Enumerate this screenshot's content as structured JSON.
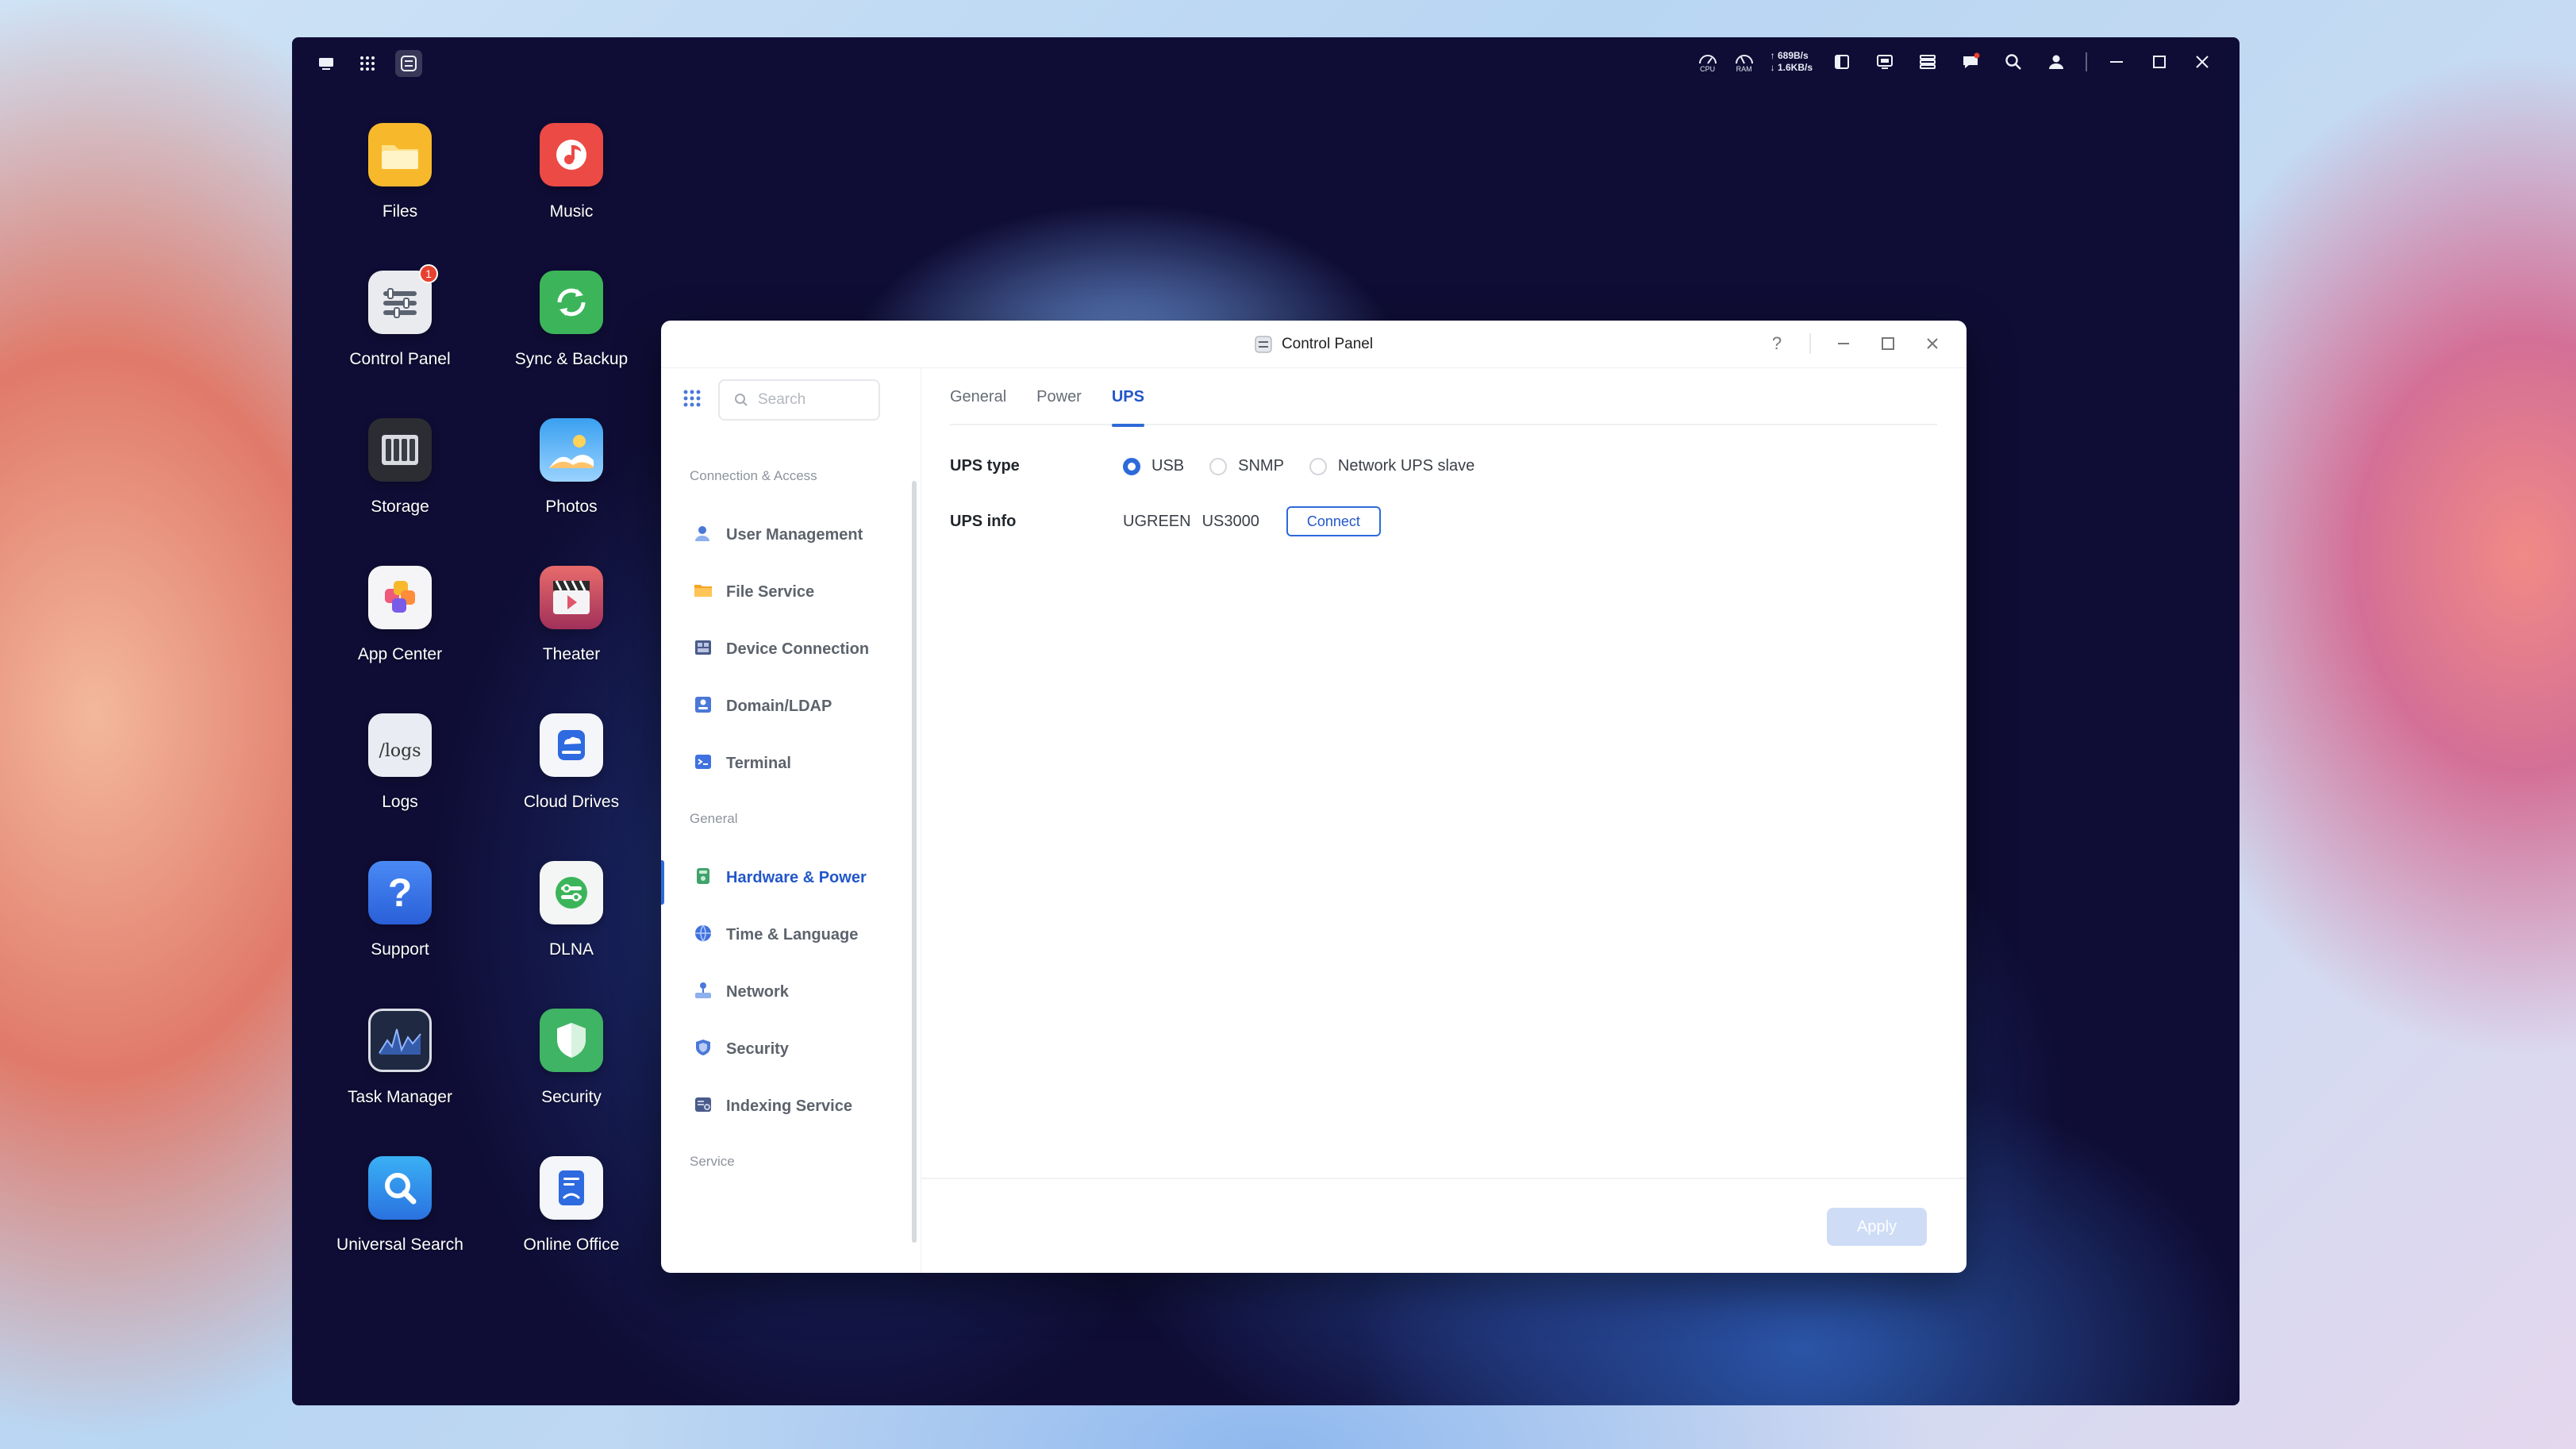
{
  "desktop": {
    "icons": [
      {
        "label": "Files",
        "icon": "folder-icon",
        "color": "#f7b92b"
      },
      {
        "label": "Music",
        "icon": "music-note-icon",
        "color": "#ec4a45"
      },
      {
        "label": "Control Panel",
        "icon": "sliders-icon",
        "color": "#e9ebef",
        "badge": "1"
      },
      {
        "label": "Sync & Backup",
        "icon": "sync-icon",
        "color": "#3cb55a"
      },
      {
        "label": "Storage",
        "icon": "drive-bay-icon",
        "color": "#2b2d33"
      },
      {
        "label": "Photos",
        "icon": "landscape-icon",
        "color": "#3aa0f0"
      },
      {
        "label": "App Center",
        "icon": "app-blocks-icon",
        "color": "#f5f5f7"
      },
      {
        "label": "Theater",
        "icon": "clapperboard-icon",
        "color": "#b23b5d"
      },
      {
        "label": "Logs",
        "icon": "logs-icon",
        "color": "#e9ecf2",
        "text": "/logs"
      },
      {
        "label": "Cloud Drives",
        "icon": "cloud-drive-icon",
        "color": "#f4f6fa"
      },
      {
        "label": "Support",
        "icon": "question-icon",
        "color": "#2e6ae0"
      },
      {
        "label": "DLNA",
        "icon": "dlna-icon",
        "color": "#f4f6f5"
      },
      {
        "label": "Task Manager",
        "icon": "activity-graph-icon",
        "color": "#1f2942"
      },
      {
        "label": "Security",
        "icon": "shield-icon",
        "color": "#3fb464"
      },
      {
        "label": "Universal Search",
        "icon": "search-icon",
        "color": "#2a8ae8"
      },
      {
        "label": "Online Office",
        "icon": "document-icon",
        "color": "#f4f6fa"
      }
    ]
  },
  "topbar": {
    "monitor": {
      "cpu": "CPU",
      "ram": "RAM",
      "up": "↑ 689B/s",
      "down": "↓ 1.6KB/s"
    }
  },
  "window": {
    "title": "Control Panel",
    "search_placeholder": "Search",
    "nav": [
      {
        "type": "section",
        "label": "Connection & Access"
      },
      {
        "type": "item",
        "label": "User Management",
        "icon": "user-icon",
        "color": "#4b78d8"
      },
      {
        "type": "item",
        "label": "File Service",
        "icon": "folder-icon",
        "color": "#f5a623"
      },
      {
        "type": "item",
        "label": "Device Connection",
        "icon": "device-icon",
        "color": "#4a5b8a"
      },
      {
        "type": "item",
        "label": "Domain/LDAP",
        "icon": "domain-icon",
        "color": "#4b78d8"
      },
      {
        "type": "item",
        "label": "Terminal",
        "icon": "terminal-icon",
        "color": "#3f72e0"
      },
      {
        "type": "section",
        "label": "General"
      },
      {
        "type": "item",
        "label": "Hardware & Power",
        "icon": "hardware-icon",
        "color": "#3fa36b",
        "active": true
      },
      {
        "type": "item",
        "label": "Time & Language",
        "icon": "globe-icon",
        "color": "#3f72e0"
      },
      {
        "type": "item",
        "label": "Network",
        "icon": "network-icon",
        "color": "#4b78d8"
      },
      {
        "type": "item",
        "label": "Security",
        "icon": "shield-icon",
        "color": "#4b78d8"
      },
      {
        "type": "item",
        "label": "Indexing Service",
        "icon": "index-icon",
        "color": "#4a5b8a"
      },
      {
        "type": "section",
        "label": "Service"
      }
    ],
    "tabs": [
      {
        "label": "General",
        "active": false
      },
      {
        "label": "Power",
        "active": false
      },
      {
        "label": "UPS",
        "active": true
      }
    ],
    "ups_type": {
      "label": "UPS type",
      "options": [
        {
          "label": "USB",
          "selected": true
        },
        {
          "label": "SNMP",
          "selected": false
        },
        {
          "label": "Network UPS slave",
          "selected": false
        }
      ]
    },
    "ups_info": {
      "label": "UPS info",
      "vendor": "UGREEN",
      "model": "US3000",
      "connect_label": "Connect"
    },
    "apply_label": "Apply"
  },
  "colors": {
    "accent": "#2d6ad9",
    "desktop_bg": "#0f0d35"
  }
}
